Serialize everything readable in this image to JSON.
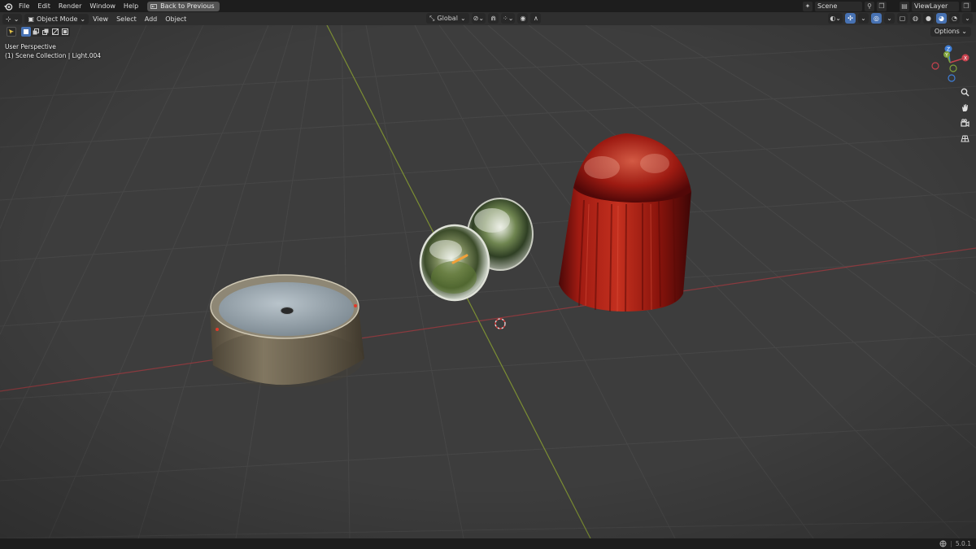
{
  "topbar": {
    "menus": [
      "File",
      "Edit",
      "Render",
      "Window",
      "Help"
    ],
    "back_label": "Back to Previous",
    "scene_name": "Scene",
    "view_layer": "ViewLayer"
  },
  "viewport_header": {
    "mode_label": "Object Mode",
    "menus": [
      "View",
      "Select",
      "Add",
      "Object"
    ],
    "orientation": "Global"
  },
  "viewport": {
    "perspective_label": "User Perspective",
    "collection_label": "(1) Scene Collection | Light.004",
    "options_label": "Options",
    "axes": {
      "x": "X",
      "y": "Y",
      "z": "Z"
    }
  },
  "statusbar": {
    "version": "5.0.1"
  },
  "colors": {
    "accent": "#4772b3",
    "x_axis": "#c8424e",
    "y_axis": "#7ea13a",
    "z_axis": "#3f7ed6",
    "viewport_bg": "#3d3d3d"
  }
}
